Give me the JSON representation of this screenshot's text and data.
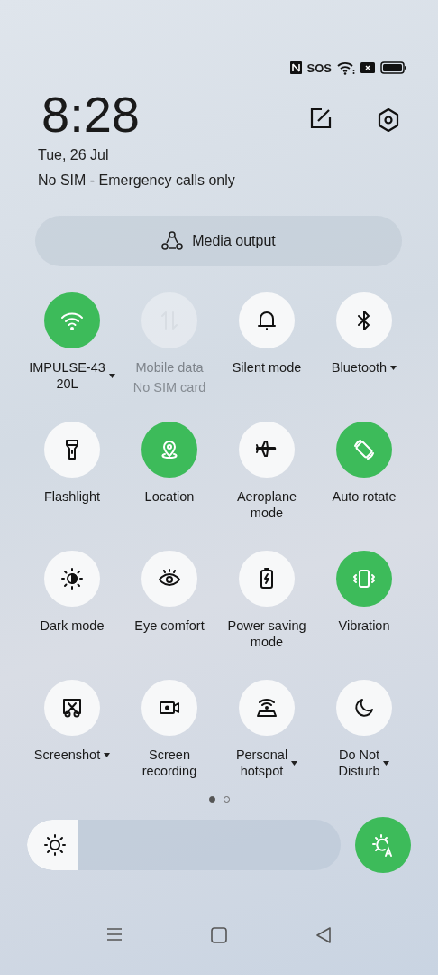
{
  "status_bar": {
    "sos": "SOS"
  },
  "header": {
    "time": "8:28",
    "date": "Tue, 26 Jul",
    "network": "No SIM - Emergency calls only"
  },
  "media_output": {
    "label": "Media output"
  },
  "tiles": [
    {
      "kind": "wifi",
      "lines": [
        "IMPULSE-43",
        "20L"
      ],
      "on": true,
      "disabled": false,
      "dropdown": true
    },
    {
      "kind": "data",
      "lines": [
        "Mobile data"
      ],
      "sublabel": "No SIM card",
      "on": false,
      "disabled": true,
      "dropdown": false
    },
    {
      "kind": "bell",
      "lines": [
        "Silent mode"
      ],
      "on": false,
      "disabled": false,
      "dropdown": false
    },
    {
      "kind": "bluetooth",
      "lines": [
        "Bluetooth"
      ],
      "on": false,
      "disabled": false,
      "dropdown": true
    },
    {
      "kind": "flashlight",
      "lines": [
        "Flashlight"
      ],
      "on": false,
      "disabled": false,
      "dropdown": false
    },
    {
      "kind": "location",
      "lines": [
        "Location"
      ],
      "on": true,
      "disabled": false,
      "dropdown": false
    },
    {
      "kind": "plane",
      "lines": [
        "Aeroplane",
        "mode"
      ],
      "on": false,
      "disabled": false,
      "dropdown": false
    },
    {
      "kind": "rotate",
      "lines": [
        "Auto rotate"
      ],
      "on": true,
      "disabled": false,
      "dropdown": false
    },
    {
      "kind": "dark",
      "lines": [
        "Dark mode"
      ],
      "on": false,
      "disabled": false,
      "dropdown": false
    },
    {
      "kind": "eye",
      "lines": [
        "Eye comfort"
      ],
      "on": false,
      "disabled": false,
      "dropdown": false
    },
    {
      "kind": "battery",
      "lines": [
        "Power saving",
        "mode"
      ],
      "on": false,
      "disabled": false,
      "dropdown": false
    },
    {
      "kind": "vibration",
      "lines": [
        "Vibration"
      ],
      "on": true,
      "disabled": false,
      "dropdown": false
    },
    {
      "kind": "screenshot",
      "lines": [
        "Screenshot"
      ],
      "on": false,
      "disabled": false,
      "dropdown": true
    },
    {
      "kind": "record",
      "lines": [
        "Screen",
        "recording"
      ],
      "on": false,
      "disabled": false,
      "dropdown": false
    },
    {
      "kind": "hotspot",
      "lines": [
        "Personal",
        "hotspot"
      ],
      "on": false,
      "disabled": false,
      "dropdown": true
    },
    {
      "kind": "moon",
      "lines": [
        "Do Not",
        "Disturb"
      ],
      "on": false,
      "disabled": false,
      "dropdown": true
    }
  ],
  "pages": [
    {
      "selected": true
    },
    {
      "selected": false
    }
  ],
  "brightness": {
    "level": 0.16,
    "auto": true
  }
}
